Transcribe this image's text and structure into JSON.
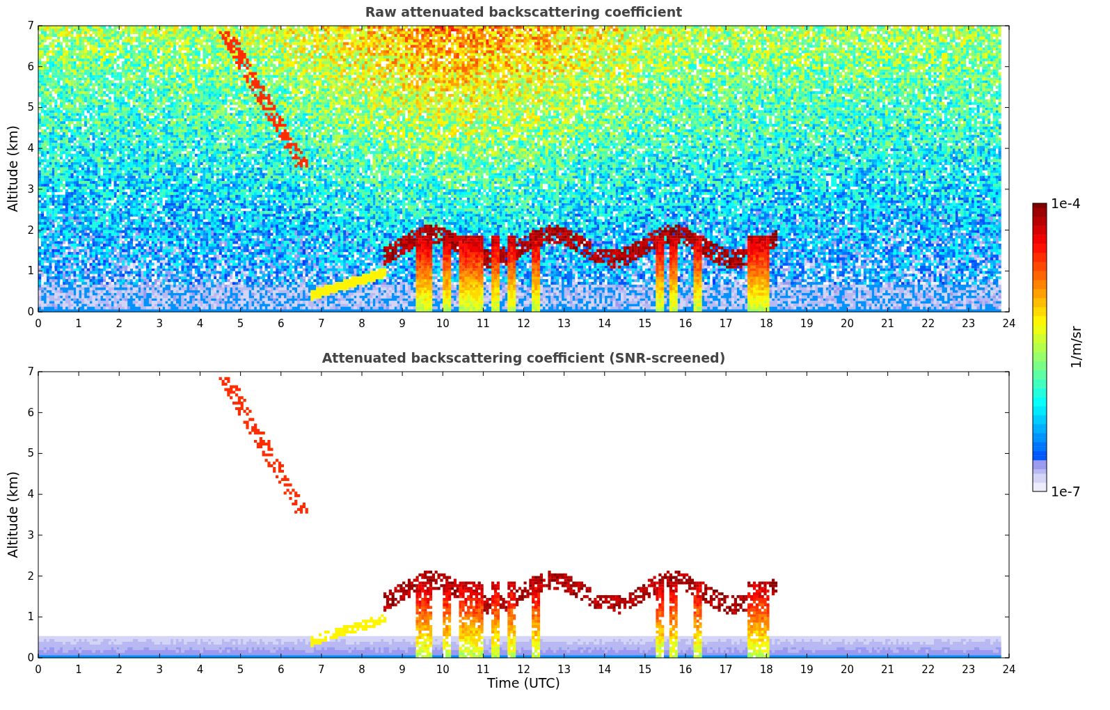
{
  "panels": [
    {
      "title": "Raw attenuated backscattering coefficient",
      "kind": "raw",
      "ylabel": "Altitude (km)",
      "yticks": [
        "7",
        "6",
        "5",
        "4",
        "3",
        "2",
        "1",
        "0"
      ],
      "xticks": [
        "0",
        "1",
        "2",
        "3",
        "4",
        "5",
        "6",
        "7",
        "8",
        "9",
        "10",
        "11",
        "12",
        "13",
        "14",
        "15",
        "16",
        "17",
        "18",
        "19",
        "20",
        "21",
        "22",
        "23",
        "24"
      ]
    },
    {
      "title": "Attenuated backscattering coefficient (SNR-screened)",
      "kind": "screened",
      "ylabel": "Altitude (km)",
      "yticks": [
        "7",
        "6",
        "5",
        "4",
        "3",
        "2",
        "1",
        "0"
      ],
      "xticks": [
        "0",
        "1",
        "2",
        "3",
        "4",
        "5",
        "6",
        "7",
        "8",
        "9",
        "10",
        "11",
        "12",
        "13",
        "14",
        "15",
        "16",
        "17",
        "18",
        "19",
        "20",
        "21",
        "22",
        "23",
        "24"
      ],
      "xlabel": "Time (UTC)"
    }
  ],
  "colorbar": {
    "label": "1/m/sr",
    "max_label": "1e-4",
    "min_label": "1e-7"
  }
}
